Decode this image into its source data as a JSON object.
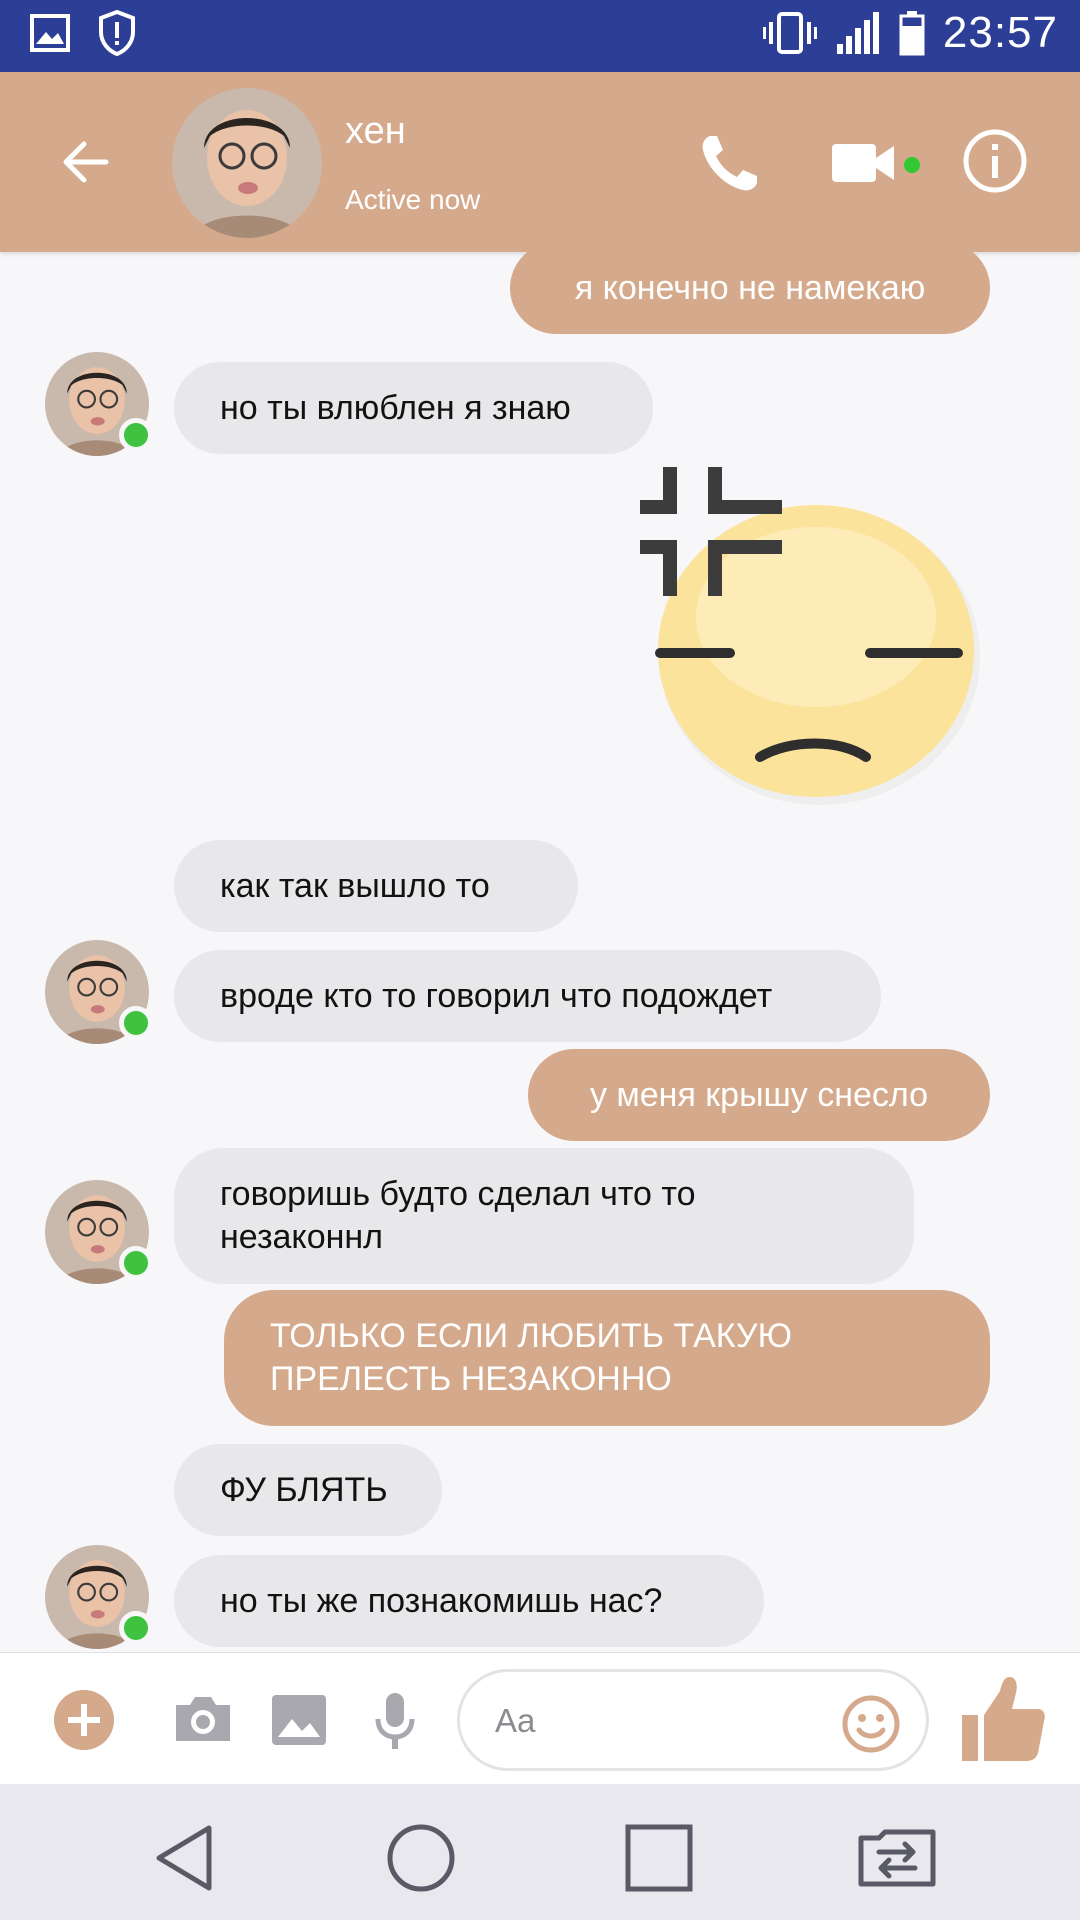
{
  "status_bar": {
    "time": "23:57",
    "icons": [
      "image-icon",
      "shield-alert-icon",
      "vibrate-icon",
      "signal-icon",
      "battery-icon"
    ]
  },
  "header": {
    "name": "хен",
    "status": "Active now",
    "accent": "#d5a98b",
    "icons": [
      "back-arrow-icon",
      "phone-icon",
      "video-icon",
      "info-icon"
    ]
  },
  "messages": [
    {
      "side": "out",
      "text": "я конечно не намекаю"
    },
    {
      "side": "in",
      "text": "но ты влюблен я знаю"
    },
    {
      "side": "out",
      "type": "sticker",
      "sticker": "annoyed-face-sticker"
    },
    {
      "side": "in",
      "text": "как так вышло то"
    },
    {
      "side": "in",
      "text": "вроде кто то говорил что подождет"
    },
    {
      "side": "out",
      "text": "у меня крышу снесло"
    },
    {
      "side": "in",
      "text": "говоришь будто сделал что то незаконнл"
    },
    {
      "side": "out",
      "text": "ТОЛЬКО ЕСЛИ ЛЮБИТЬ ТАКУЮ ПРЕЛЕСТЬ НЕЗАКОННО"
    },
    {
      "side": "in",
      "text": "ФУ БЛЯТЬ"
    },
    {
      "side": "in",
      "text": "но ты же познакомишь нас?"
    }
  ],
  "composer": {
    "placeholder": "Aa",
    "icons": [
      "plus-icon",
      "camera-icon",
      "gallery-icon",
      "mic-icon",
      "emoji-icon",
      "thumbs-up-icon"
    ]
  },
  "nav_bar": {
    "icons": [
      "back-triangle-icon",
      "home-circle-icon",
      "recents-square-icon",
      "switch-sim-icon"
    ]
  }
}
